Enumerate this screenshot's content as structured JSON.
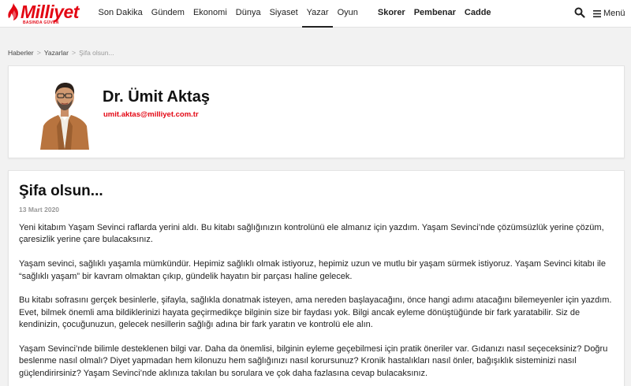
{
  "header": {
    "logo_text": "Milliyet",
    "logo_tagline": "BASINDA GÜVEN",
    "brand_color": "#e30613",
    "nav": [
      {
        "label": "Son Dakika",
        "active": false,
        "strong": false
      },
      {
        "label": "Gündem",
        "active": false,
        "strong": false
      },
      {
        "label": "Ekonomi",
        "active": false,
        "strong": false
      },
      {
        "label": "Dünya",
        "active": false,
        "strong": false
      },
      {
        "label": "Siyaset",
        "active": false,
        "strong": false
      },
      {
        "label": "Yazar",
        "active": true,
        "strong": false
      },
      {
        "label": "Oyun",
        "active": false,
        "strong": false
      }
    ],
    "nav_extra": [
      {
        "label": "Skorer"
      },
      {
        "label": "Pembenar"
      },
      {
        "label": "Cadde"
      }
    ],
    "search_icon": "search-icon",
    "menu_label": "Menü",
    "menu_icon": "hamburger-icon"
  },
  "breadcrumb": [
    {
      "label": "Haberler"
    },
    {
      "label": "Yazarlar"
    },
    {
      "label": "Şifa olsun..."
    }
  ],
  "author": {
    "name": "Dr. Ümit Aktaş",
    "email": "umit.aktas@milliyet.com.tr"
  },
  "article": {
    "title": "Şifa olsun...",
    "date": "13 Mart 2020",
    "paragraphs": [
      "Yeni kitabım Yaşam Sevinci raflarda yerini aldı. Bu kitabı sağlığınızın kontrolünü ele almanız için yazdım. Yaşam Sevinci’nde çözümsüzlük yerine çözüm, çaresizlik yerine çare bulacaksınız.",
      "Yaşam sevinci, sağlıklı yaşamla mümkündür. Hepimiz sağlıklı olmak istiyoruz, hepimiz uzun ve mutlu bir yaşam sürmek istiyoruz. Yaşam Sevinci kitabı ile “sağlıklı yaşam” bir kavram olmaktan çıkıp, gündelik hayatın bir parçası haline gelecek.",
      "Bu kitabı sofrasını gerçek besinlerle, şifayla, sağlıkla donatmak isteyen, ama nereden başlayacağını, önce hangi adımı atacağını bilemeyenler için yazdım.",
      "Evet, bilmek önemli ama bildiklerinizi hayata geçirmedikçe bilginin size bir faydası yok. Bilgi ancak eyleme dönüştüğünde bir fark yaratabilir. Siz de kendinizin, çocuğunuzun, gelecek nesillerin sağlığı adına bir fark yaratın ve kontrolü ele alın.",
      "Yaşam Sevinci’nde bilimle desteklenen bilgi var. Daha da önemlisi, bilginin eyleme geçebilmesi için pratik öneriler var. Gıdanızı nasıl seçeceksiniz? Doğru beslenme nasıl olmalı? Diyet yapmadan hem kilonuzu hem sağlığınızı nasıl korursunuz? Kronik hastalıkları nasıl önler, bağışıklık sisteminizi nasıl güçlendirirsiniz? Yaşam Sevinci’nde aklınıza takılan bu sorulara ve çok daha fazlasına cevap bulacaksınız."
    ]
  }
}
